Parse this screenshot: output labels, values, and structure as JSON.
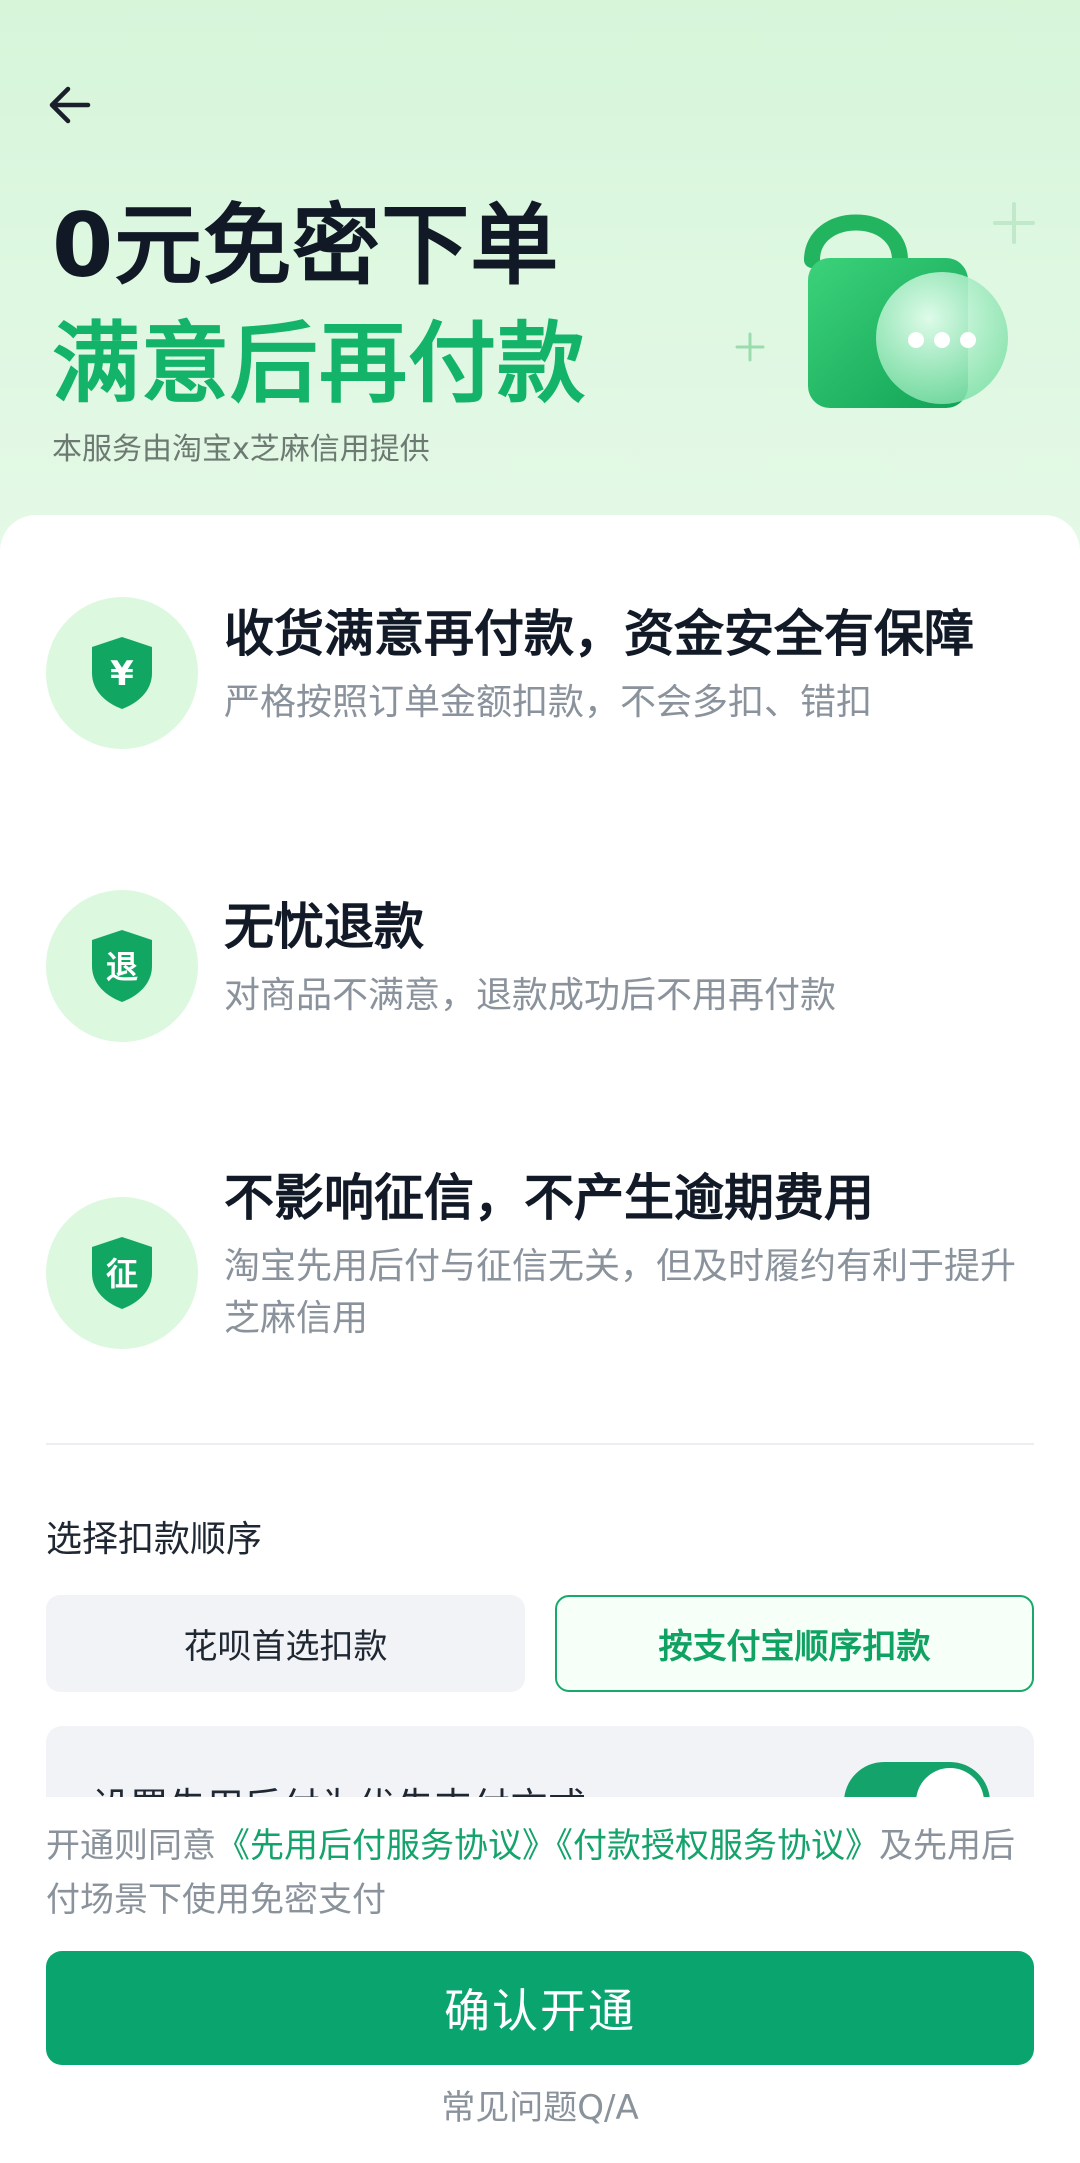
{
  "hero": {
    "title": "0元免密下单",
    "subtitle": "满意后再付款",
    "provider": "本服务由淘宝x芝麻信用提供",
    "accent_color": "#13b36a"
  },
  "benefits": [
    {
      "icon": "shield-yuan-icon",
      "icon_text": "¥",
      "title": "收货满意再付款，资金安全有保障",
      "desc": "严格按照订单金额扣款，不会多扣、错扣"
    },
    {
      "icon": "shield-refund-icon",
      "icon_text": "退",
      "title": "无忧退款",
      "desc": "对商品不满意，退款成功后不用再付款"
    },
    {
      "icon": "shield-credit-icon",
      "icon_text": "征",
      "title": "不影响征信，不产生逾期费用",
      "desc": "淘宝先用后付与征信无关，但及时履约有利于提升芝麻信用"
    }
  ],
  "payment_order": {
    "label": "选择扣款顺序",
    "options": [
      {
        "label": "花呗首选扣款",
        "selected": false
      },
      {
        "label": "按支付宝顺序扣款",
        "selected": true
      }
    ]
  },
  "setting": {
    "label": "设置先用后付为优先支付方式",
    "toggle_on": true
  },
  "footer": {
    "agreement_prefix": "开通则同意",
    "agreement_link1": "《先用后付服务协议》",
    "agreement_link2": "《付款授权服务协议》",
    "agreement_suffix": "及先用后付场景下使用免密支付",
    "confirm_label": "确认开通",
    "faq_label": "常见问题Q/A"
  },
  "colors": {
    "primary_button": "#0aa46f",
    "link": "#14a36a",
    "hero_background": "#d6f5d9"
  }
}
